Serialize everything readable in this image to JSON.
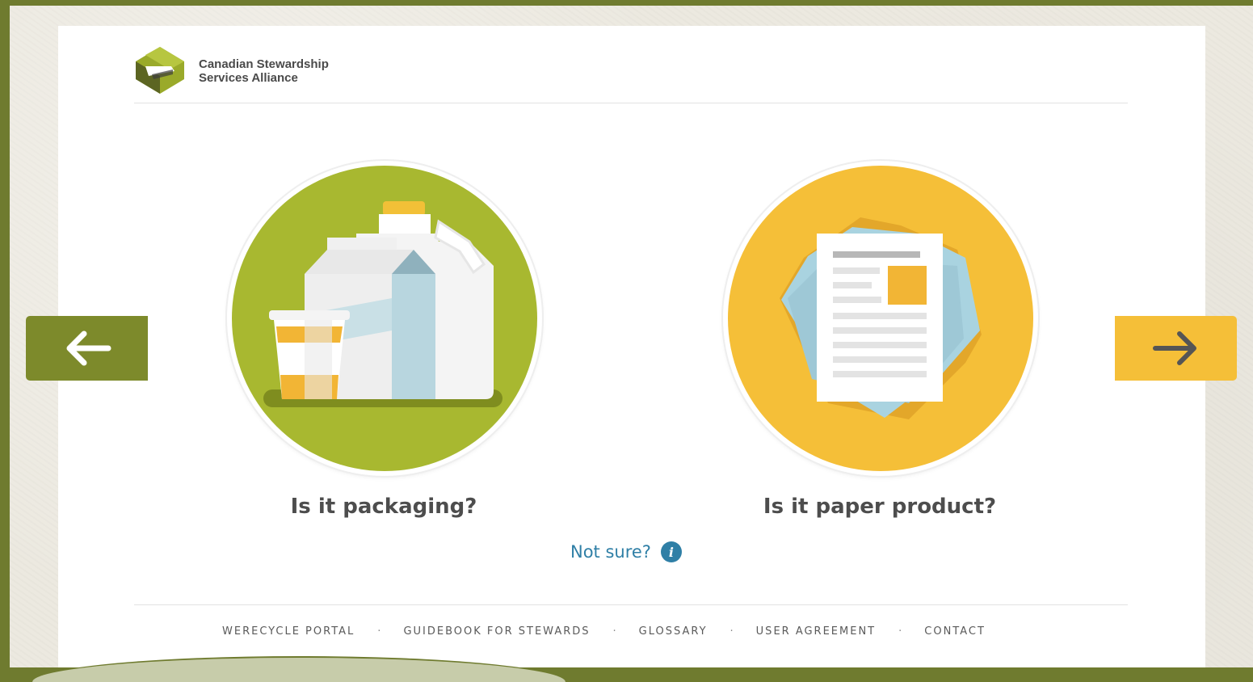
{
  "brand": {
    "line1": "Canadian Stewardship",
    "line2": "Services Alliance"
  },
  "options": {
    "packaging": {
      "label": "Is it packaging?",
      "color": "#a8b830",
      "icon": "packaging-illustration"
    },
    "paper": {
      "label": "Is it paper product?",
      "color": "#f5bf38",
      "icon": "paper-illustration"
    }
  },
  "help": {
    "label": "Not sure?",
    "icon": "info-icon",
    "glyph": "i"
  },
  "navigation": {
    "prev_icon": "arrow-left-icon",
    "next_icon": "arrow-right-icon",
    "prev_color": "#7d8a2b",
    "next_color": "#f5bf38"
  },
  "footer": {
    "links": [
      "WERECYCLE PORTAL",
      "GUIDEBOOK FOR STEWARDS",
      "GLOSSARY",
      "USER AGREEMENT",
      "CONTACT"
    ],
    "separator": "·"
  }
}
